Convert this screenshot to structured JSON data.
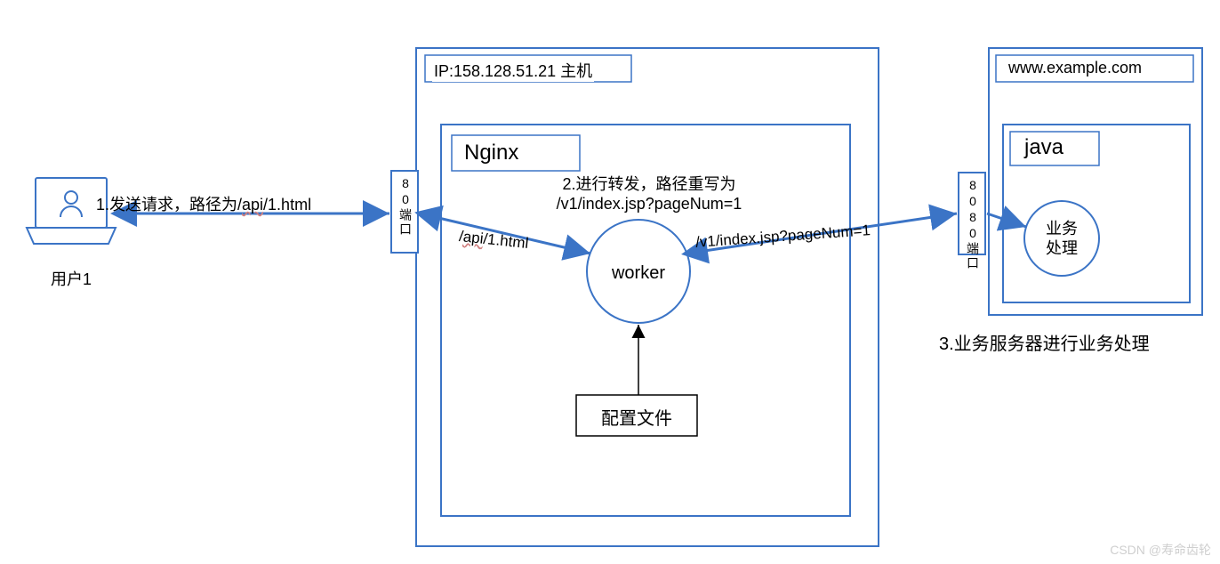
{
  "diagram": {
    "user": {
      "label": "用户1"
    },
    "host": {
      "title": "IP:158.128.51.21 主机"
    },
    "port80": {
      "label": "80端口"
    },
    "nginx": {
      "title": "Nginx"
    },
    "arrow1": {
      "prefix": "1.发送请求，路径为/",
      "api": "api",
      "suffix": "/1.html"
    },
    "arrow2": {
      "line1": "2.进行转发，路径重写为",
      "line2": "/v1/index.jsp?pageNum=1"
    },
    "path_left": "/api/1.html",
    "worker": {
      "label": "worker"
    },
    "config": {
      "label": "配置文件"
    },
    "path_right": "/v1/index.jsp?pageNum=1",
    "port8080": {
      "label": "8080端口"
    },
    "backend": {
      "host": "www.example.com",
      "java": "java",
      "circle1": "业务",
      "circle2": "处理",
      "caption": "3.业务服务器进行业务处理"
    },
    "watermark": "CSDN @寿命齿轮"
  },
  "colors": {
    "blue": "#3b74c6",
    "black": "#000000",
    "light": "#ffffff"
  }
}
